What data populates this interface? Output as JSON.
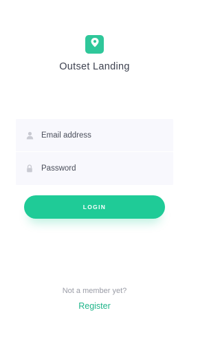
{
  "app": {
    "title": "Outset Landing",
    "logo_icon": "map-pin-icon",
    "accent_color": "#1fcb97"
  },
  "form": {
    "email": {
      "placeholder": "Email address",
      "icon": "user-icon"
    },
    "password": {
      "placeholder": "Password",
      "icon": "lock-icon"
    },
    "submit_label": "LOGIN"
  },
  "footer": {
    "prompt": "Not a member yet?",
    "register_label": "Register"
  }
}
